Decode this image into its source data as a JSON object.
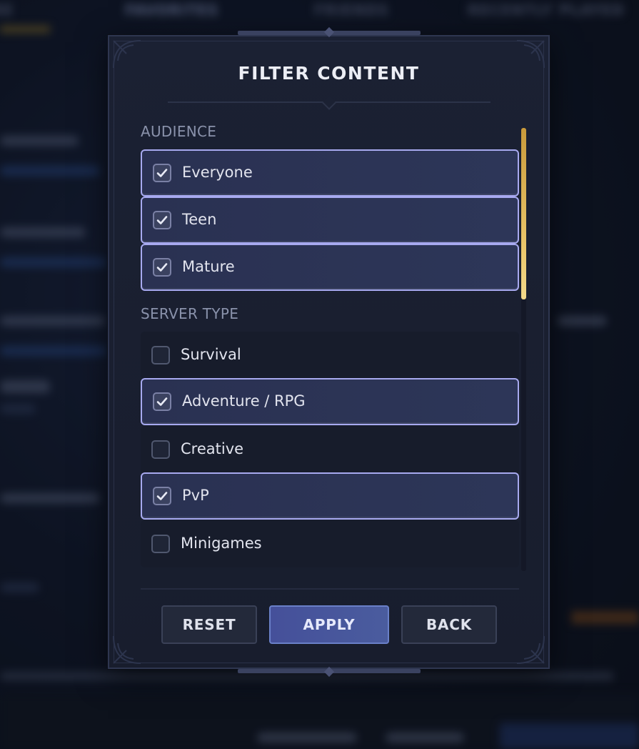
{
  "background": {
    "tabs": [
      "FAVORITES",
      "FRIENDS",
      "RECENTLY PLAYED"
    ]
  },
  "modal": {
    "title": "FILTER CONTENT",
    "sections": [
      {
        "label": "AUDIENCE",
        "options": [
          {
            "label": "Everyone",
            "checked": true
          },
          {
            "label": "Teen",
            "checked": true
          },
          {
            "label": "Mature",
            "checked": true
          }
        ]
      },
      {
        "label": "SERVER TYPE",
        "options": [
          {
            "label": "Survival",
            "checked": false
          },
          {
            "label": "Adventure / RPG",
            "checked": true
          },
          {
            "label": "Creative",
            "checked": false
          },
          {
            "label": "PvP",
            "checked": true
          },
          {
            "label": "Minigames",
            "checked": false
          }
        ]
      }
    ],
    "buttons": {
      "reset": "RESET",
      "apply": "APPLY",
      "back": "BACK"
    }
  },
  "colors": {
    "accent": "#a7a9ef",
    "scroll_gold": "#ebc76b",
    "apply_blue": "#4a5c9e",
    "panel": "#1b2133"
  }
}
